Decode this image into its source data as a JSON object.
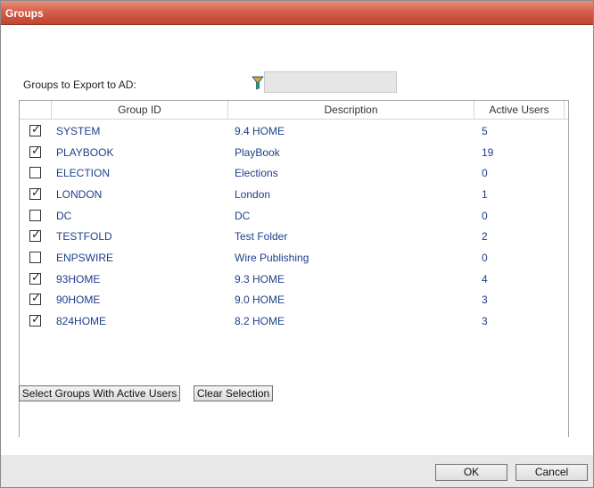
{
  "window": {
    "title": "Groups"
  },
  "filter": {
    "label": "Groups to Export to AD:",
    "value": "",
    "icon": "filter-icon"
  },
  "grid": {
    "headers": {
      "group_id": "Group ID",
      "description": "Description",
      "active_users": "Active Users"
    },
    "rows": [
      {
        "checked": true,
        "group_id": "SYSTEM",
        "description": "9.4 HOME",
        "active_users": "5"
      },
      {
        "checked": true,
        "group_id": "PLAYBOOK",
        "description": "PlayBook",
        "active_users": "19"
      },
      {
        "checked": false,
        "group_id": "ELECTION",
        "description": "Elections",
        "active_users": "0"
      },
      {
        "checked": true,
        "group_id": "LONDON",
        "description": "London",
        "active_users": "1"
      },
      {
        "checked": false,
        "group_id": "DC",
        "description": "DC",
        "active_users": "0"
      },
      {
        "checked": true,
        "group_id": "TESTFOLD",
        "description": "Test Folder",
        "active_users": "2"
      },
      {
        "checked": false,
        "group_id": "ENPSWIRE",
        "description": "Wire Publishing",
        "active_users": "0"
      },
      {
        "checked": true,
        "group_id": "93HOME",
        "description": "9.3 HOME",
        "active_users": "4"
      },
      {
        "checked": true,
        "group_id": "90HOME",
        "description": "9.0 HOME",
        "active_users": "3"
      },
      {
        "checked": true,
        "group_id": "824HOME",
        "description": "8.2 HOME",
        "active_users": "3"
      }
    ]
  },
  "actions": {
    "select_active_label": "Select Groups With Active Users",
    "clear_label": "Clear Selection"
  },
  "footer": {
    "ok_label": "OK",
    "cancel_label": "Cancel"
  },
  "colors": {
    "title_bar": "#c94e3a",
    "link_text": "#1e3f8c",
    "footer_bg": "#e8e8e8",
    "filter_icon": "#2e8b8b"
  }
}
